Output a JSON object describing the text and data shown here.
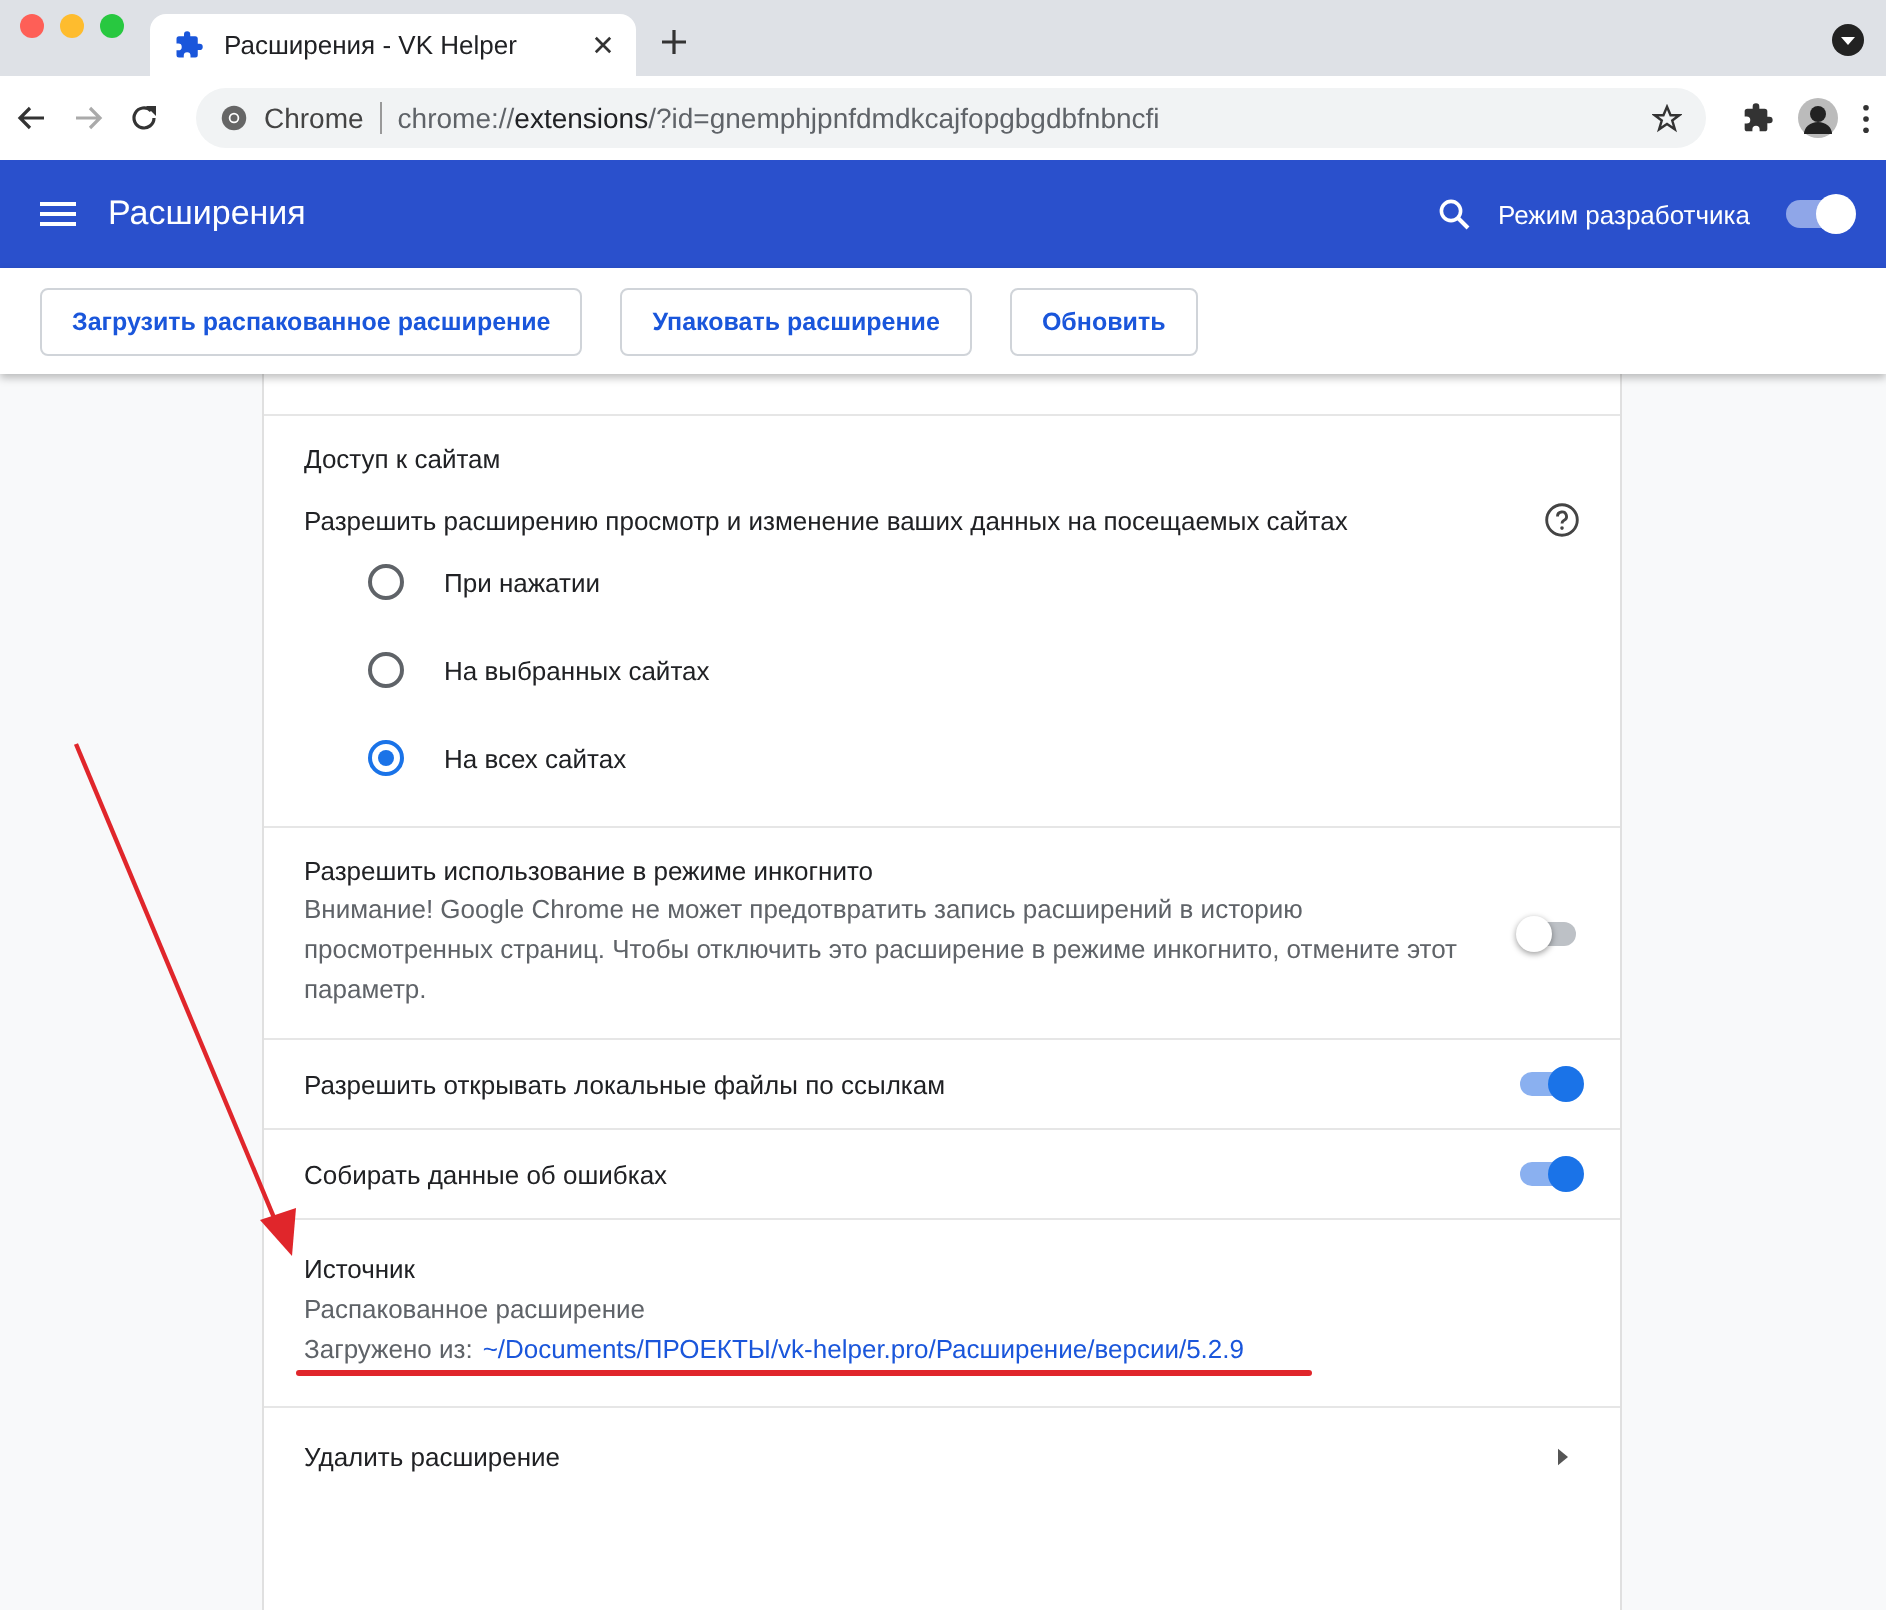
{
  "browser": {
    "tab": {
      "title": "Расширения - VK Helper"
    },
    "address": {
      "scheme_label": "Chrome",
      "url_prefix": "chrome://",
      "url_host": "extensions",
      "url_rest": "/?id=gnemphjpnfdmdkcajfopgbgdbfnbncfi"
    }
  },
  "header": {
    "title": "Расширения",
    "dev_mode": {
      "label": "Режим разработчика",
      "on": true
    }
  },
  "buttons": [
    "Загрузить распакованное расширение",
    "Упаковать расширение",
    "Обновить"
  ],
  "site_access": {
    "title": "Доступ к сайтам",
    "prompt": "Разрешить расширению просмотр и изменение ваших данных на посещаемых сайтах",
    "options": [
      {
        "label": "При нажатии",
        "selected": false
      },
      {
        "label": "На выбранных сайтах",
        "selected": false
      },
      {
        "label": "На всех сайтах",
        "selected": true
      }
    ]
  },
  "settings": [
    {
      "title": "Разрешить использование в режиме инкогнито",
      "description": "Внимание! Google Chrome не может предотвратить запись расширений в историю просмотренных страниц. Чтобы отключить это расширение в режиме инкогнито, отмените этот параметр.",
      "on": false
    },
    {
      "title": "Разрешить открывать локальные файлы по ссылкам",
      "on": true
    },
    {
      "title": "Собирать данные об ошибках",
      "on": true
    }
  ],
  "source": {
    "title": "Источник",
    "type": "Распакованное расширение",
    "loaded_label": "Загружено из:",
    "path": "~/Documents/ПРОЕКТЫ/vk-helper.pro/Расширение/версии/5.2.9"
  },
  "remove": {
    "label": "Удалить расширение"
  }
}
